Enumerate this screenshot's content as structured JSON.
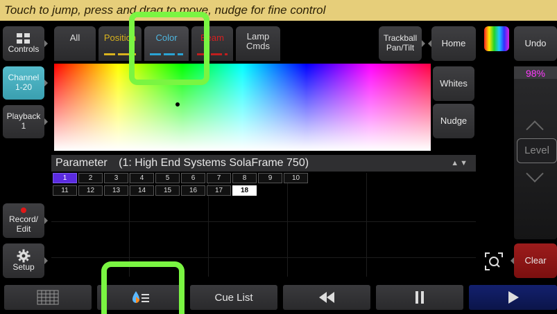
{
  "hint": "Touch to jump, press and drag to move, nudge for fine control",
  "side": {
    "controls": "Controls",
    "channel": "Channel\n1-20",
    "playback": "Playback\n1",
    "record": "Record/\nEdit",
    "setup": "Setup"
  },
  "tabs": [
    {
      "label": "All",
      "bar_color": ""
    },
    {
      "label": "Position",
      "bar_color": "#d8b21e"
    },
    {
      "label": "Color",
      "bar_color": "#2aa3d4"
    },
    {
      "label": "Beam",
      "bar_color": "#c01e1e"
    },
    {
      "label": "Lamp\nCmds",
      "bar_color": ""
    }
  ],
  "top_right": {
    "trackball": "Trackball\nPan/Tilt",
    "home": "Home",
    "undo": "Undo"
  },
  "picker": {
    "whites": "Whites",
    "nudge": "Nudge"
  },
  "parameter": {
    "label": "Parameter",
    "fixture": "(1: High End Systems SolaFrame 750)",
    "arrows": "▲▼"
  },
  "channels": [
    "1",
    "2",
    "3",
    "4",
    "5",
    "6",
    "7",
    "8",
    "9",
    "10",
    "11",
    "12",
    "13",
    "14",
    "15",
    "16",
    "17",
    "18"
  ],
  "active_channel": "1",
  "selected_channel": "18",
  "level": {
    "value": "98%",
    "label": "Level"
  },
  "clear": "Clear",
  "bottom": {
    "cue_list": "Cue List"
  },
  "colors": {
    "hint_bg": "#e6ce7a",
    "accent_teal": "#3aa5b8",
    "clear_red": "#8e1414",
    "highlight": "#7af542",
    "play_blue": "#0e1a5a"
  }
}
